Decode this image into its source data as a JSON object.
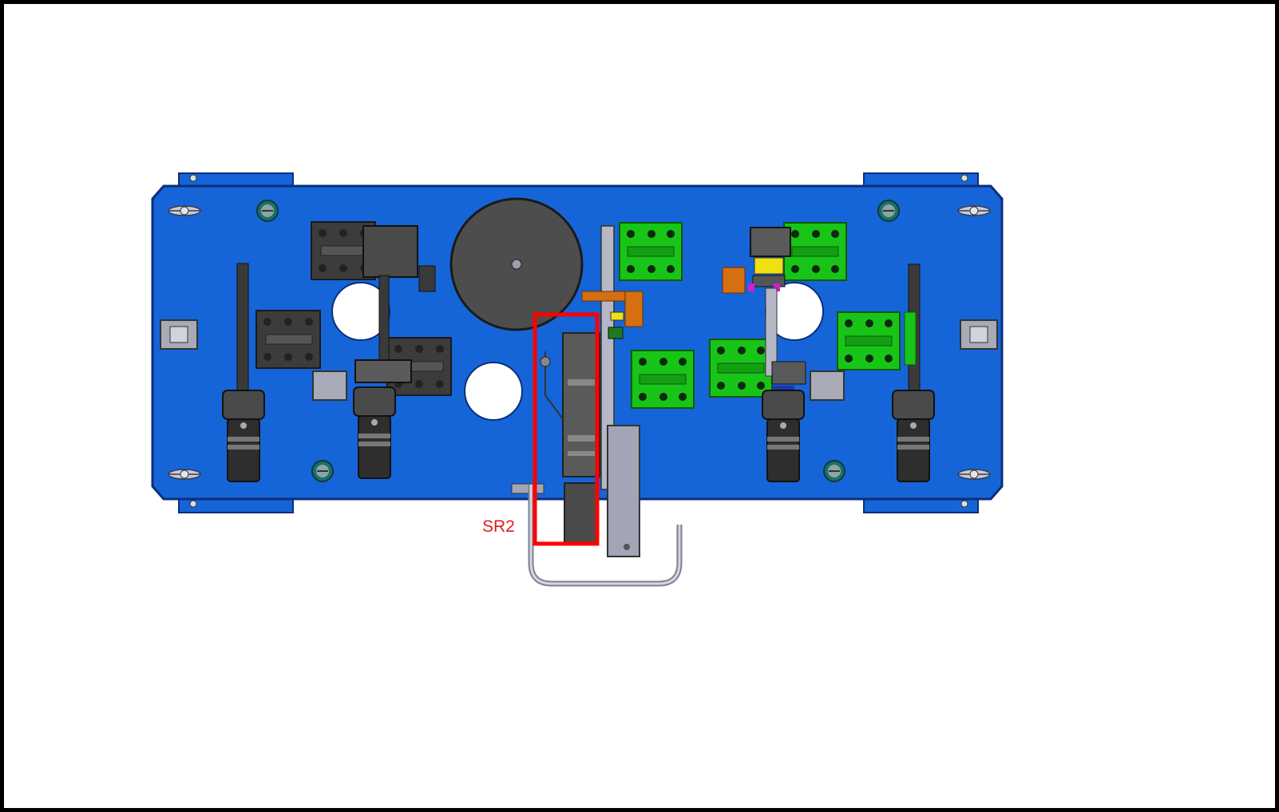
{
  "drawing": {
    "background": "#ffffff",
    "border_color": "#000000",
    "plate_color": "#1565d8",
    "clamp_color": "#3f3f3f",
    "locator_green": "#16c816",
    "accent_orange": "#d46f12",
    "accent_yellow": "#f0e010",
    "accent_magenta": "#d020c8",
    "highlight_color": "#ff0000"
  },
  "callout": {
    "label": "SR2",
    "color": "#e31b1b"
  }
}
